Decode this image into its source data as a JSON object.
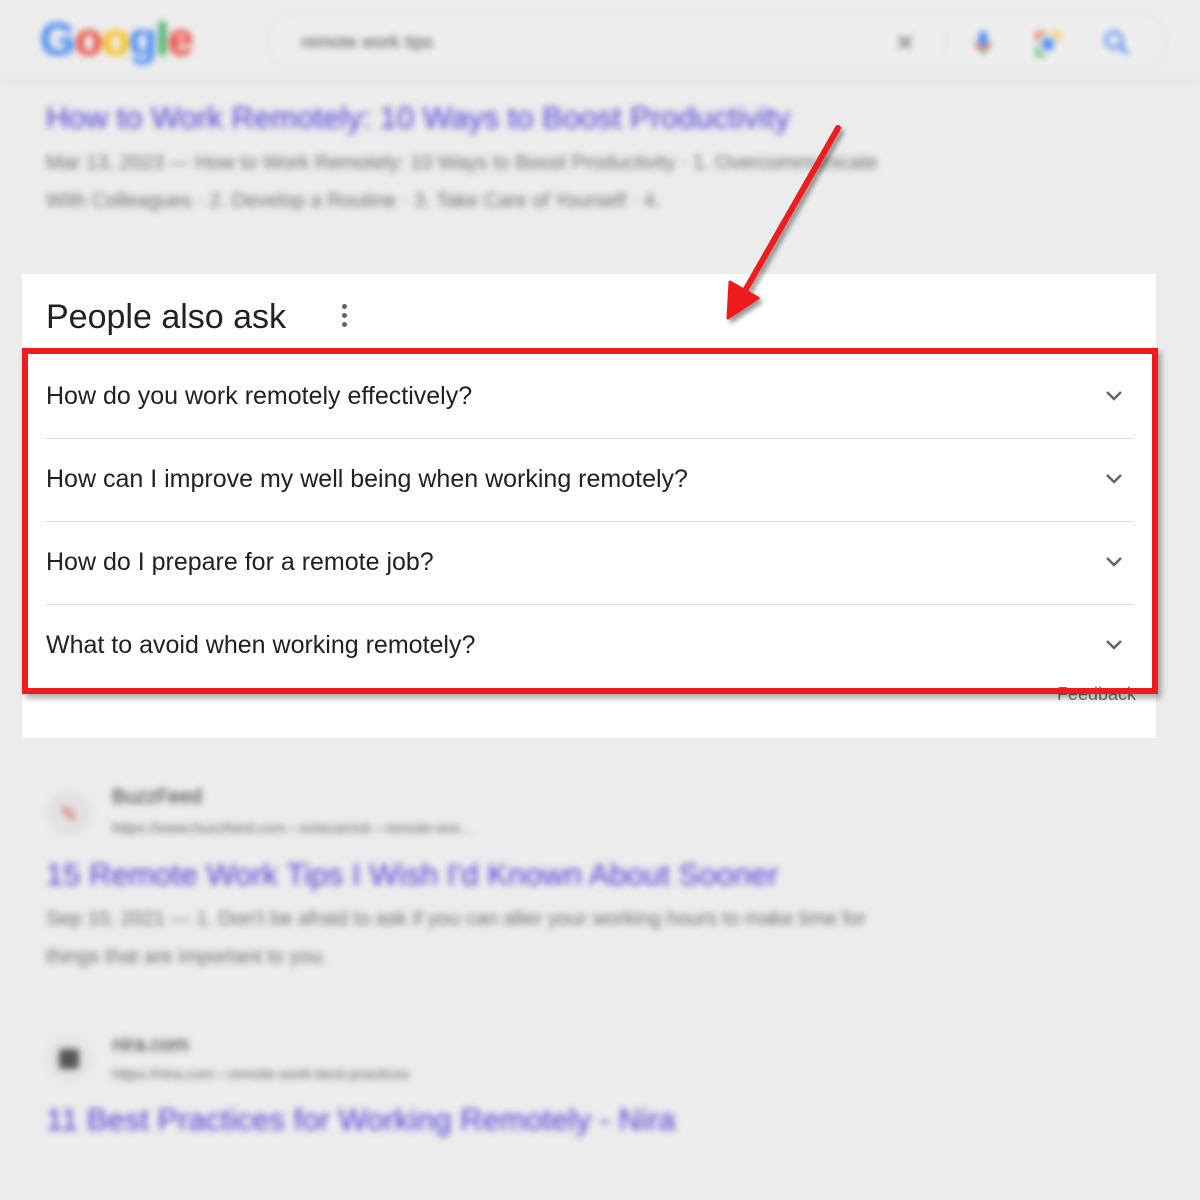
{
  "search": {
    "query": "remote work tips",
    "clear_icon": "close-icon",
    "voice_icon": "microphone-icon",
    "lens_icon": "camera-lens-icon",
    "search_icon": "search-icon"
  },
  "logo": {
    "letters": [
      "G",
      "o",
      "o",
      "g",
      "l",
      "e"
    ]
  },
  "results_top": {
    "title": "How to Work Remotely: 10 Ways to Boost Productivity",
    "snippet_line1": "Mar 13, 2023 — How to Work Remotely: 10 Ways to Boost Productivity · 1. Overcommunicate",
    "snippet_line2": "With Colleagues · 2. Develop a Routine · 3. Take Care of Yourself · 4."
  },
  "paa": {
    "title": "People also ask",
    "questions": [
      "How do you work remotely effectively?",
      "How can I improve my well being when working remotely?",
      "How do I prepare for a remote job?",
      "What to avoid when working remotely?"
    ],
    "feedback": "Feedback"
  },
  "results_bottom": [
    {
      "site": "BuzzFeed",
      "url": "https://www.buzzfeed.com › eviecarrick › remote-wor...",
      "title": "15 Remote Work Tips I Wish I'd Known About Sooner",
      "snippet_line1": "Sep 10, 2021 — 1. Don't be afraid to ask if you can alter your working hours to make time for",
      "snippet_line2": "things that are important to you."
    },
    {
      "site": "nira.com",
      "url": "https://nira.com › remote-work-best-practices",
      "title": "11 Best Practices for Working Remotely - Nira"
    }
  ],
  "colors": {
    "annotation": "#ee1c1c",
    "link": "#4b3bd6",
    "logo_blue": "#4285f4",
    "logo_red": "#ea4335",
    "logo_yellow": "#fbbc05",
    "logo_green": "#34a853"
  }
}
